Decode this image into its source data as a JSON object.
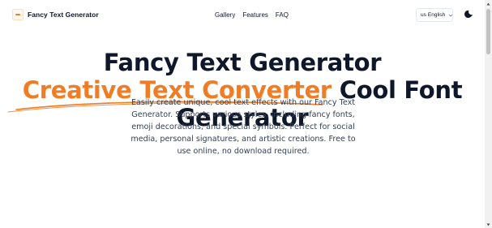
{
  "header": {
    "brand_name": "Fancy Text Generator",
    "brand_icon": "brand-logo-icon",
    "nav": [
      {
        "label": "Gallery"
      },
      {
        "label": "Features"
      },
      {
        "label": "FAQ"
      }
    ],
    "language": {
      "flag": "us",
      "selected": "English",
      "icon": "chevron-down-icon"
    },
    "theme_toggle_icon": "moon-icon"
  },
  "hero": {
    "title_line1": "Fancy Text Generator",
    "title_accent": "Creative Text Converter",
    "title_line2_rest": " Cool Font",
    "title_line3": "Generator",
    "description": "Easily create unique, cool text effects with our Fancy Text Generator. Supports various styles, including fancy fonts, emoji decorations, and special symbols. Perfect for social media, personal signatures, and artistic creations. Free to use online, no download required."
  },
  "colors": {
    "accent": "#f07c25",
    "text": "#0f172a",
    "muted": "#334155"
  }
}
